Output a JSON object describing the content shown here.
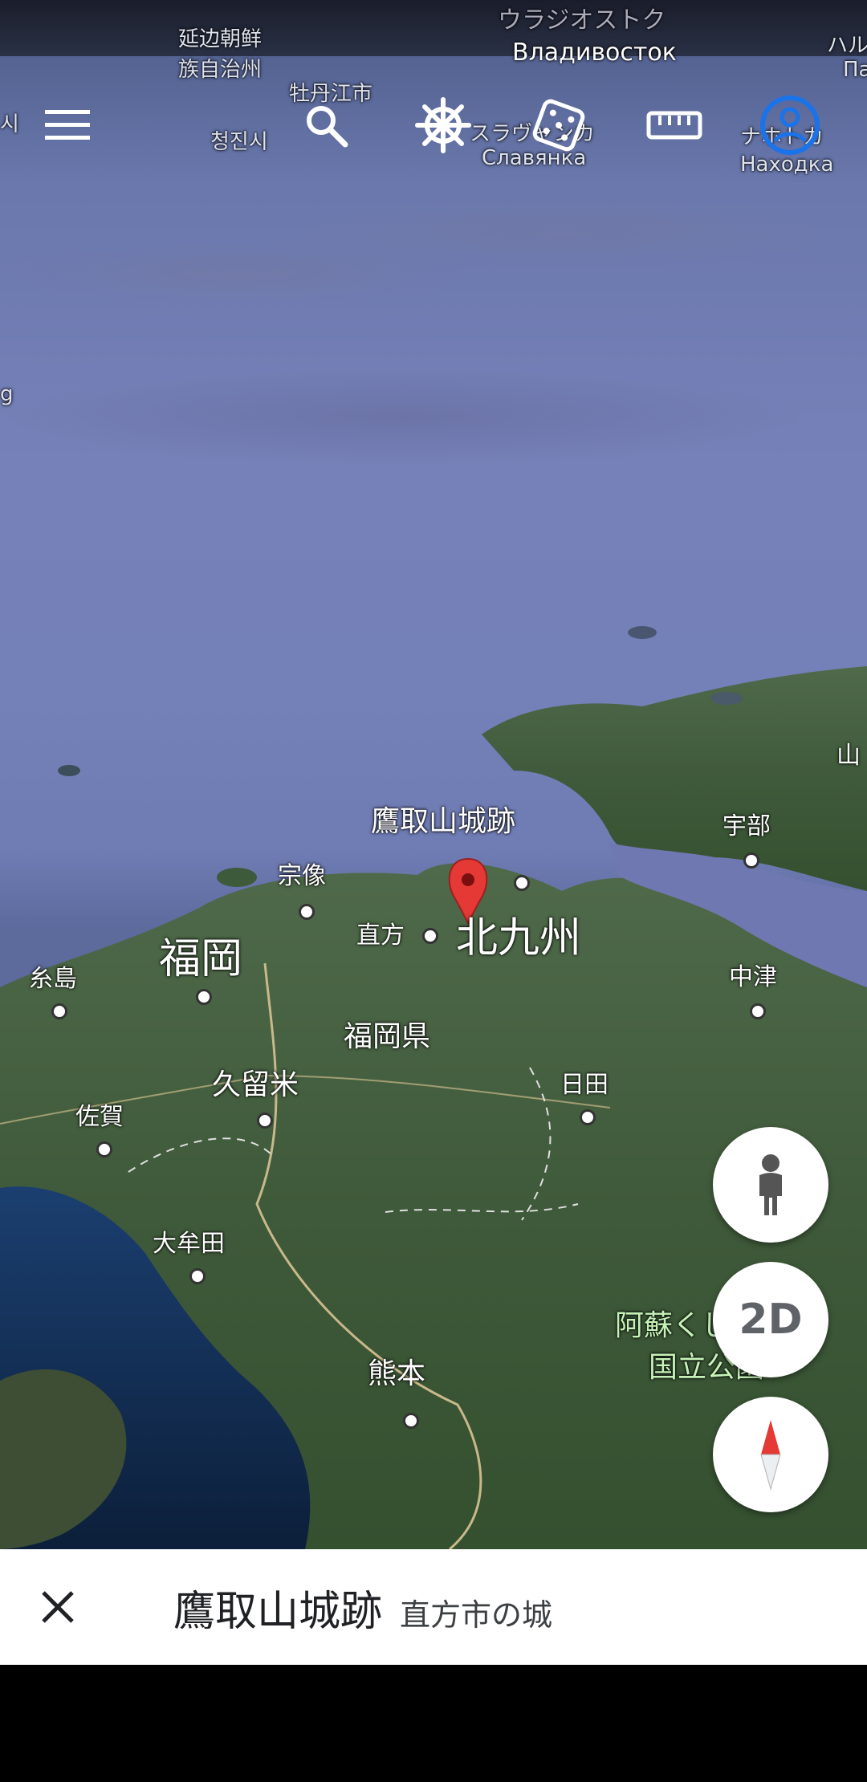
{
  "toolbar": {
    "icons": [
      "menu-icon",
      "search-icon",
      "voyager-wheel-icon",
      "dice-icon",
      "ruler-icon",
      "my-location-icon"
    ]
  },
  "map_labels": {
    "korea_china_1": "延边朝鲜",
    "korea_china_2": "族自治州",
    "mudanjiang": "牡丹江市",
    "chongjin": "청진시",
    "vladivostok_jp": "ウラジオストク",
    "vladivostok_ru": "Владивосток",
    "slavyanka_jp": "スラヴャンカ",
    "slavyanka_ru": "Славянка",
    "nakhodka_jp": "ナホトカ",
    "nakhodka_ru": "Находка",
    "edge_left_top": "시",
    "edge_left_mid": "g",
    "edge_right_top1": "ハル",
    "edge_right_top2": "Па",
    "yamaguchi_edge": "山",
    "place_name": "鷹取山城跡",
    "munakata": "宗像",
    "ube": "宇部",
    "nogata": "直方",
    "kitakyushu": "北九州",
    "fukuoka": "福岡",
    "itoshima": "糸島",
    "nakatsu": "中津",
    "fukuoka_pref": "福岡県",
    "kurume": "久留米",
    "hita": "日田",
    "saga": "佐賀",
    "omuta": "大牟田",
    "aso_1": "阿蘇くじゅう",
    "aso_2": "国立公園",
    "kumamoto": "熊本"
  },
  "fabs": {
    "streetview_icon": "pegman-icon",
    "view_mode": "2D",
    "compass_icon": "compass-icon"
  },
  "place_card": {
    "title": "鷹取山城跡",
    "subtitle": "直方市の城"
  },
  "colors": {
    "pin": "#e53935",
    "location_blue": "#1a73e8"
  }
}
